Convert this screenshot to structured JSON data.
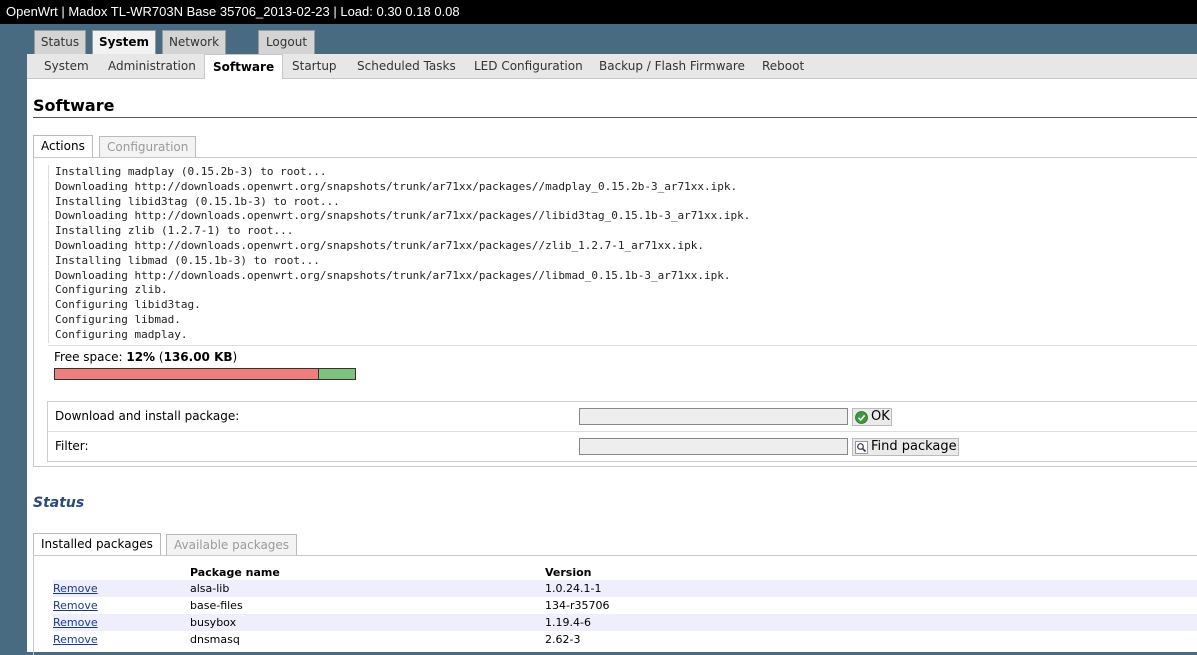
{
  "window_title": "OpenWrt | Madox TL-WR703N Base 35706_2013-02-23 | Load: 0.30 0.18 0.08",
  "top_menu": [
    {
      "label": "Status"
    },
    {
      "label": "System"
    },
    {
      "label": "Network"
    },
    {
      "label": "Logout"
    }
  ],
  "sub_menu": [
    {
      "label": "System"
    },
    {
      "label": "Administration"
    },
    {
      "label": "Software"
    },
    {
      "label": "Startup"
    },
    {
      "label": "Scheduled Tasks"
    },
    {
      "label": "LED Configuration"
    },
    {
      "label": "Backup / Flash Firmware"
    },
    {
      "label": "Reboot"
    }
  ],
  "page_title": "Software",
  "section_tabs": {
    "actions": "Actions",
    "configuration": "Configuration"
  },
  "log_lines": [
    "Installing madplay (0.15.2b-3) to root...",
    "Downloading http://downloads.openwrt.org/snapshots/trunk/ar71xx/packages//madplay_0.15.2b-3_ar71xx.ipk.",
    "Installing libid3tag (0.15.1b-3) to root...",
    "Downloading http://downloads.openwrt.org/snapshots/trunk/ar71xx/packages//libid3tag_0.15.1b-3_ar71xx.ipk.",
    "Installing zlib (1.2.7-1) to root...",
    "Downloading http://downloads.openwrt.org/snapshots/trunk/ar71xx/packages//zlib_1.2.7-1_ar71xx.ipk.",
    "Installing libmad (0.15.1b-3) to root...",
    "Downloading http://downloads.openwrt.org/snapshots/trunk/ar71xx/packages//libmad_0.15.1b-3_ar71xx.ipk.",
    "Configuring zlib.",
    "Configuring libid3tag.",
    "Configuring libmad.",
    "Configuring madplay."
  ],
  "free_space": {
    "label": "Free space:",
    "percent": "12%",
    "size": "136.00 KB",
    "used_fraction": 0.88
  },
  "download_form": {
    "label": "Download and install package:",
    "value": "",
    "button": "OK"
  },
  "filter_form": {
    "label": "Filter:",
    "value": "",
    "button": "Find package"
  },
  "status_heading": "Status",
  "package_tabs": {
    "installed": "Installed packages",
    "available": "Available packages"
  },
  "packages_table": {
    "columns": [
      "Package name",
      "Version"
    ],
    "remove_label": "Remove",
    "rows": [
      {
        "name": "alsa-lib",
        "version": "1.0.24.1-1"
      },
      {
        "name": "base-files",
        "version": "134-r35706"
      },
      {
        "name": "busybox",
        "version": "1.19.4-6"
      },
      {
        "name": "dnsmasq",
        "version": "2.62-3"
      }
    ]
  },
  "colors": {
    "background": "#496b82",
    "bar_used": "#ee7f7d",
    "bar_free": "#7fc27d",
    "status_heading": "#2a4a7a",
    "link": "#1a3a8a"
  }
}
